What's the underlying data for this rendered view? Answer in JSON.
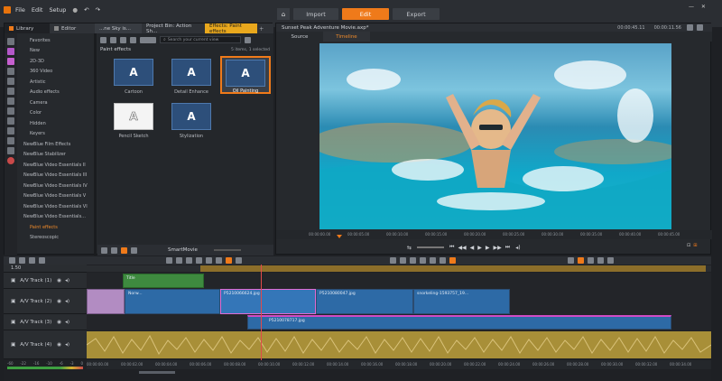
{
  "menu": {
    "items": [
      "File",
      "Edit",
      "Setup"
    ]
  },
  "modes": {
    "import": "Import",
    "edit": "Edit",
    "export": "Export"
  },
  "timecode_top": "00:00:45.11",
  "timecode_top2": "00:00:11.56",
  "library_tabs": {
    "library": "Library",
    "editor": "Editor"
  },
  "tabs": [
    "...ne Sky is...",
    "Project Bin: Action Sh...",
    "Effects: Paint effects"
  ],
  "search": {
    "placeholder": "Search your current view"
  },
  "nav_items": [
    "Favorites",
    "New",
    "2D-3D",
    "360 Video",
    "Artistic",
    "Audio effects",
    "Camera",
    "Color",
    "Hidden",
    "Keyers",
    "NewBlue Film Effects",
    "NewBlue Stabilizer",
    "NewBlue Video Essentials II",
    "NewBlue Video Essentials III",
    "NewBlue Video Essentials IV",
    "NewBlue Video Essentials V",
    "NewBlue Video Essentials VI",
    "NewBlue Video Essentials...",
    "Paint effects",
    "Stereoscopic"
  ],
  "paint_effects": {
    "heading": "Paint effects",
    "count": "5 items, 1 selected",
    "items": [
      "Cartoon",
      "Detail Enhance",
      "Oil Painting",
      "Pencil Sketch",
      "Stylization"
    ]
  },
  "smartmovie": "SmartMovie",
  "preview": {
    "title": "Sunset Peak Adventure Movie.axp*",
    "tab_source": "Source",
    "tab_timeline": "Timeline",
    "ruler": [
      "00:00:00.00",
      "00:00:05.00",
      "00:00:10.00",
      "00:00:15.00",
      "00:00:20.00",
      "00:00:25.00",
      "00:00:30.00",
      "00:00:35.00",
      "00:00:40.00",
      "00:00:45.00"
    ]
  },
  "tracks": [
    {
      "name": "A/V Track (1)"
    },
    {
      "name": "A/V Track (2)"
    },
    {
      "name": "A/V Track (3)"
    },
    {
      "name": "A/V Track (4)"
    }
  ],
  "timeline_top_label": "1.50",
  "clips": {
    "green_clip": "Title",
    "c1": "Norw...",
    "c2": "P5210066624.jpg",
    "c3": "P5210080047.jpg",
    "c4": "snorkeling-1593757_19...",
    "c5": "P5210078717.jpg"
  },
  "bottom_ruler": [
    "00:00:00.00",
    "00:00:02.00",
    "00:00:04.00",
    "00:00:06.00",
    "00:00:08.00",
    "00:00:10.00",
    "00:00:12.00",
    "00:00:14.00",
    "00:00:16.00",
    "00:00:18.00",
    "00:00:20.00",
    "00:00:22.00",
    "00:00:24.00",
    "00:00:26.00",
    "00:00:28.00",
    "00:00:30.00",
    "00:00:32.00",
    "00:00:34.00"
  ],
  "level_labels": [
    "-60",
    "-22",
    "-16",
    "-10",
    "-6",
    "-3",
    "0"
  ]
}
